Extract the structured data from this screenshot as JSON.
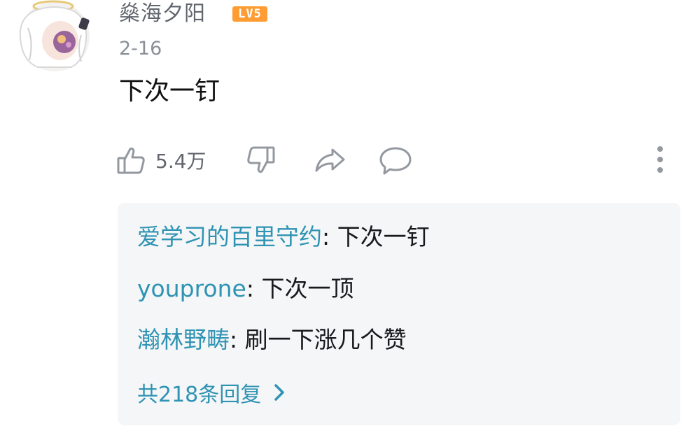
{
  "comment": {
    "username": "燊海夕阳",
    "level": "LV5",
    "date": "2-16",
    "text": "下次一钉"
  },
  "actions": {
    "like_count": "5.4万",
    "like_icon": "thumbs-up-icon",
    "dislike_icon": "thumbs-down-icon",
    "share_icon": "share-icon",
    "reply_icon": "comment-bubble-icon",
    "more_icon": "more-vertical-icon"
  },
  "replies": {
    "items": [
      {
        "user": "爱学习的百里守约",
        "separator": ": ",
        "text": "下次一钉"
      },
      {
        "user": "youprone",
        "separator": ": ",
        "text": "下次一顶"
      },
      {
        "user": "瀚林野畴",
        "separator": ": ",
        "text": "刷一下涨几个赞"
      }
    ],
    "total_label": "共218条回复"
  },
  "colors": {
    "link_blue": "#2f93b3",
    "level_orange": "#ff9d34",
    "reply_bg": "#f5f6f7",
    "secondary_text": "#61666d"
  }
}
